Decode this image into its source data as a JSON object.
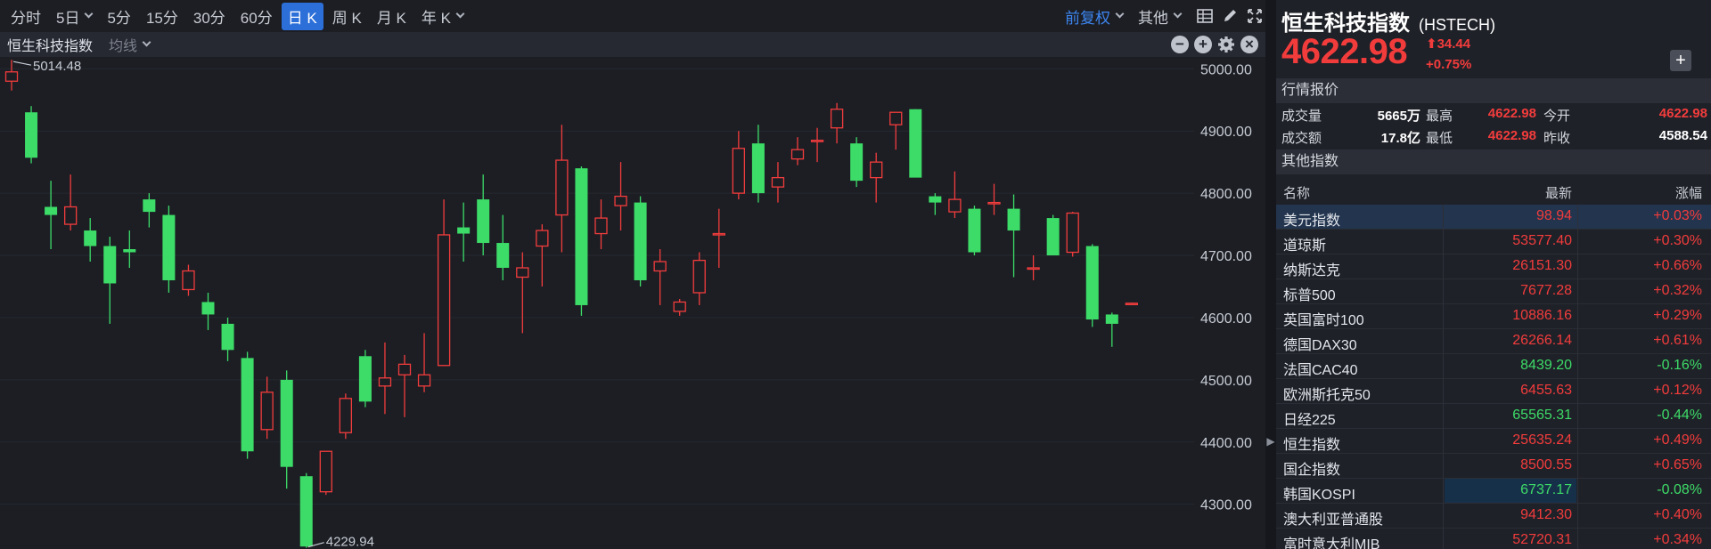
{
  "toolbar": {
    "periods": [
      "分时",
      "5日",
      "5分",
      "15分",
      "30分",
      "60分",
      "日 K",
      "周 K",
      "月 K",
      "年 K"
    ],
    "active_period": "日 K",
    "fq_label": "前复权",
    "other_label": "其他"
  },
  "subbar": {
    "title": "恒生科技指数",
    "ma_label": "均线"
  },
  "chart_data": {
    "type": "candlestick",
    "y_ticks": [
      "5000.00",
      "4900.00",
      "4800.00",
      "4700.00",
      "4600.00",
      "4500.00",
      "4400.00",
      "4300.00"
    ],
    "ylim": [
      4228,
      5019
    ],
    "annotations": {
      "high": "5014.48",
      "low": "4229.94"
    },
    "up_color": "#f23c3c",
    "down_color": "#3ddc68",
    "last_price_line": 4622.98,
    "candles": [
      {
        "o": 4980,
        "h": 5014.48,
        "l": 4965,
        "c": 4995
      },
      {
        "o": 4930,
        "h": 4940,
        "l": 4848,
        "c": 4857
      },
      {
        "o": 4778,
        "h": 4820,
        "l": 4710,
        "c": 4765
      },
      {
        "o": 4750,
        "h": 4830,
        "l": 4740,
        "c": 4778
      },
      {
        "o": 4740,
        "h": 4760,
        "l": 4690,
        "c": 4715
      },
      {
        "o": 4715,
        "h": 4730,
        "l": 4590,
        "c": 4655
      },
      {
        "o": 4710,
        "h": 4740,
        "l": 4680,
        "c": 4705
      },
      {
        "o": 4790,
        "h": 4800,
        "l": 4745,
        "c": 4770
      },
      {
        "o": 4765,
        "h": 4780,
        "l": 4640,
        "c": 4660
      },
      {
        "o": 4645,
        "h": 4685,
        "l": 4635,
        "c": 4675
      },
      {
        "o": 4625,
        "h": 4640,
        "l": 4580,
        "c": 4605
      },
      {
        "o": 4590,
        "h": 4600,
        "l": 4530,
        "c": 4548
      },
      {
        "o": 4535,
        "h": 4545,
        "l": 4373,
        "c": 4385
      },
      {
        "o": 4420,
        "h": 4505,
        "l": 4405,
        "c": 4480
      },
      {
        "o": 4500,
        "h": 4515,
        "l": 4325,
        "c": 4360
      },
      {
        "o": 4345,
        "h": 4350,
        "l": 4229.94,
        "c": 4232
      },
      {
        "o": 4320,
        "h": 4365,
        "l": 4315,
        "c": 4385
      },
      {
        "o": 4415,
        "h": 4478,
        "l": 4405,
        "c": 4470
      },
      {
        "o": 4538,
        "h": 4548,
        "l": 4456,
        "c": 4465
      },
      {
        "o": 4490,
        "h": 4560,
        "l": 4445,
        "c": 4503
      },
      {
        "o": 4508,
        "h": 4540,
        "l": 4440,
        "c": 4525
      },
      {
        "o": 4490,
        "h": 4575,
        "l": 4480,
        "c": 4508
      },
      {
        "o": 4523,
        "h": 4790,
        "l": 4522,
        "c": 4733
      },
      {
        "o": 4745,
        "h": 4785,
        "l": 4690,
        "c": 4735
      },
      {
        "o": 4790,
        "h": 4830,
        "l": 4700,
        "c": 4720
      },
      {
        "o": 4720,
        "h": 4765,
        "l": 4660,
        "c": 4680
      },
      {
        "o": 4665,
        "h": 4705,
        "l": 4575,
        "c": 4680
      },
      {
        "o": 4715,
        "h": 4750,
        "l": 4650,
        "c": 4740
      },
      {
        "o": 4765,
        "h": 4910,
        "l": 4705,
        "c": 4853
      },
      {
        "o": 4840,
        "h": 4843,
        "l": 4603,
        "c": 4620
      },
      {
        "o": 4735,
        "h": 4790,
        "l": 4710,
        "c": 4760
      },
      {
        "o": 4780,
        "h": 4850,
        "l": 4740,
        "c": 4795
      },
      {
        "o": 4785,
        "h": 4795,
        "l": 4650,
        "c": 4660
      },
      {
        "o": 4675,
        "h": 4710,
        "l": 4620,
        "c": 4690
      },
      {
        "o": 4610,
        "h": 4630,
        "l": 4603,
        "c": 4625
      },
      {
        "o": 4640,
        "h": 4705,
        "l": 4620,
        "c": 4692
      },
      {
        "o": 4735,
        "h": 4775,
        "l": 4680,
        "c": 4735
      },
      {
        "o": 4800,
        "h": 4900,
        "l": 4790,
        "c": 4872
      },
      {
        "o": 4880,
        "h": 4910,
        "l": 4785,
        "c": 4800
      },
      {
        "o": 4810,
        "h": 4850,
        "l": 4785,
        "c": 4825
      },
      {
        "o": 4855,
        "h": 4890,
        "l": 4845,
        "c": 4870
      },
      {
        "o": 4885,
        "h": 4905,
        "l": 4850,
        "c": 4885
      },
      {
        "o": 4905,
        "h": 4945,
        "l": 4880,
        "c": 4935
      },
      {
        "o": 4880,
        "h": 4890,
        "l": 4810,
        "c": 4820
      },
      {
        "o": 4825,
        "h": 4865,
        "l": 4785,
        "c": 4850
      },
      {
        "o": 4910,
        "h": 4930,
        "l": 4870,
        "c": 4930
      },
      {
        "o": 4935,
        "h": 4935,
        "l": 4835,
        "c": 4825
      },
      {
        "o": 4795,
        "h": 4800,
        "l": 4765,
        "c": 4785
      },
      {
        "o": 4770,
        "h": 4835,
        "l": 4760,
        "c": 4790
      },
      {
        "o": 4775,
        "h": 4780,
        "l": 4700,
        "c": 4705
      },
      {
        "o": 4785,
        "h": 4815,
        "l": 4765,
        "c": 4785
      },
      {
        "o": 4775,
        "h": 4798,
        "l": 4665,
        "c": 4740
      },
      {
        "o": 4678,
        "h": 4700,
        "l": 4660,
        "c": 4680
      },
      {
        "o": 4760,
        "h": 4765,
        "l": 4700,
        "c": 4700
      },
      {
        "o": 4705,
        "h": 4770,
        "l": 4698,
        "c": 4768
      },
      {
        "o": 4715,
        "h": 4718,
        "l": 4585,
        "c": 4597
      },
      {
        "o": 4605,
        "h": 4608,
        "l": 4553,
        "c": 4590
      },
      {
        "o": 4622,
        "h": 4624,
        "l": 4622,
        "c": 4622.98
      }
    ]
  },
  "quote": {
    "name": "恒生科技指数",
    "code": "(HSTECH)",
    "price": "4622.98",
    "change": "34.44",
    "change_pct": "+0.75%",
    "section_quote": "行情报价",
    "volume_label": "成交量",
    "volume": "5665万",
    "high_label": "最高",
    "high": "4622.98",
    "open_label": "今开",
    "open": "4622.98",
    "amount_label": "成交额",
    "amount": "17.8亿",
    "low_label": "最低",
    "low": "4622.98",
    "prev_label": "昨收",
    "prev": "4588.54",
    "section_other": "其他指数",
    "col_name": "名称",
    "col_last": "最新",
    "col_pct": "涨幅"
  },
  "indices": [
    {
      "name": "美元指数",
      "last": "98.94",
      "pct": "+0.03%",
      "dir": "up"
    },
    {
      "name": "道琼斯",
      "last": "53577.40",
      "pct": "+0.30%",
      "dir": "up"
    },
    {
      "name": "纳斯达克",
      "last": "26151.30",
      "pct": "+0.66%",
      "dir": "up"
    },
    {
      "name": "标普500",
      "last": "7677.28",
      "pct": "+0.32%",
      "dir": "up"
    },
    {
      "name": "英国富时100",
      "last": "10886.16",
      "pct": "+0.29%",
      "dir": "up"
    },
    {
      "name": "德国DAX30",
      "last": "26266.14",
      "pct": "+0.61%",
      "dir": "up"
    },
    {
      "name": "法国CAC40",
      "last": "8439.20",
      "pct": "-0.16%",
      "dir": "down"
    },
    {
      "name": "欧洲斯托克50",
      "last": "6455.63",
      "pct": "+0.12%",
      "dir": "up"
    },
    {
      "name": "日经225",
      "last": "65565.31",
      "pct": "-0.44%",
      "dir": "down"
    },
    {
      "name": "恒生指数",
      "last": "25635.24",
      "pct": "+0.49%",
      "dir": "up"
    },
    {
      "name": "国企指数",
      "last": "8500.55",
      "pct": "+0.65%",
      "dir": "up"
    },
    {
      "name": "韩国KOSPI",
      "last": "6737.17",
      "pct": "-0.08%",
      "dir": "down"
    },
    {
      "name": "澳大利亚普通股",
      "last": "9412.30",
      "pct": "+0.40%",
      "dir": "up"
    },
    {
      "name": "富时意大利MIB",
      "last": "52720.31",
      "pct": "+0.34%",
      "dir": "up"
    }
  ]
}
